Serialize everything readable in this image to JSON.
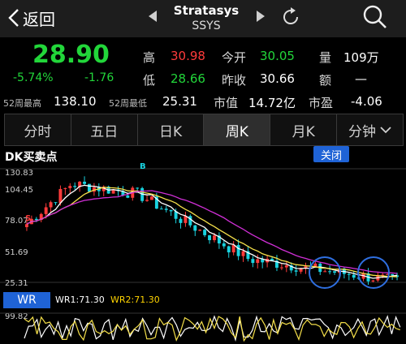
{
  "header": {
    "back_label": "返回",
    "stock_name": "Stratasys",
    "stock_code": "SSYS"
  },
  "quote": {
    "price": "28.90",
    "change_pct": "-5.74%",
    "change": "-1.76",
    "high_label": "高",
    "high": "30.98",
    "low_label": "低",
    "low": "28.66",
    "open_label": "今开",
    "open": "30.05",
    "prev_close_label": "昨收",
    "prev_close": "30.66",
    "volume_label": "量",
    "volume": "109万",
    "amount_label": "额",
    "amount": "—",
    "wk52_high_label": "52周最高",
    "wk52_high": "138.10",
    "wk52_low_label": "52周最低",
    "wk52_low": "25.31",
    "mkt_cap_label": "市值",
    "mkt_cap": "14.72亿",
    "pe_label": "市盈",
    "pe": "-4.06"
  },
  "tabs": [
    {
      "label": "分时",
      "active": false
    },
    {
      "label": "五日",
      "active": false
    },
    {
      "label": "日K",
      "active": false
    },
    {
      "label": "周K",
      "active": true
    },
    {
      "label": "月K",
      "active": false
    },
    {
      "label": "分钟",
      "active": false
    }
  ],
  "indicator": {
    "title": "DK买卖点",
    "close_label": "关闭",
    "marker_s": "S",
    "marker_b": "B"
  },
  "chart_data": {
    "type": "candlestick",
    "y_ticks": [
      "130.83",
      "104.45",
      "78.07",
      "51.69",
      "25.31"
    ],
    "ylim": [
      25.31,
      140
    ],
    "colors": {
      "up": "#ff3b3b",
      "down": "#19d3e0",
      "ma1": "#ffffff",
      "ma2": "#f5e04a",
      "ma3": "#d02fd6"
    }
  },
  "wr": {
    "button_label": "WR",
    "wr1_label": "WR1:71.30",
    "wr2_label": "WR2:71.30",
    "top_tick": "99.82"
  }
}
